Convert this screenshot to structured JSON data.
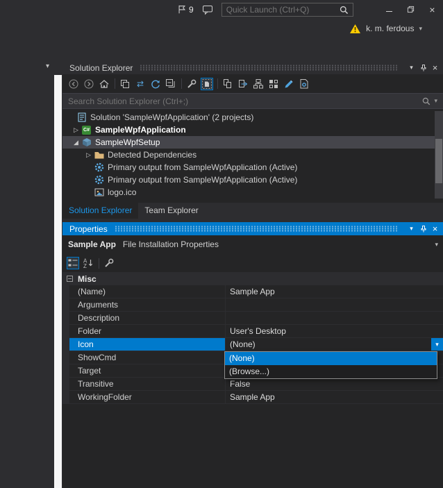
{
  "colors": {
    "background": "#2d2d30",
    "panel": "#252526",
    "accent_blue": "#007acc",
    "inactive_selection": "#45454b",
    "text": "#d0d0d0",
    "muted_text": "#999999",
    "folder_yellow": "#dcb67a",
    "warning_yellow": "#ffcc00",
    "active_tab_text": "#1c97ea"
  },
  "icons": {
    "chevron_down": "▾",
    "close": "×",
    "expander_collapsed": "▷",
    "expander_expanded": "◢",
    "csharp_label": "C#",
    "sync_arrows": "⇄"
  },
  "titlebar": {
    "notification_count": "9",
    "quick_launch_placeholder": "Quick Launch (Ctrl+Q)",
    "user_name": "k. m. ferdous"
  },
  "solution_explorer": {
    "title": "Solution Explorer",
    "search_placeholder": "Search Solution Explorer (Ctrl+;)",
    "tree": [
      {
        "label": "Solution 'SampleWpfApplication' (2 projects)"
      },
      {
        "label": "SampleWpfApplication",
        "bold": true
      },
      {
        "label": "SampleWpfSetup",
        "selected": true,
        "expanded": true
      },
      {
        "label": "Detected Dependencies"
      },
      {
        "label": "Primary output from SampleWpfApplication (Active)"
      },
      {
        "label": "Primary output from SampleWpfApplication (Active)"
      },
      {
        "label": "logo.ico"
      }
    ],
    "tabs": [
      {
        "label": "Solution Explorer",
        "active": true
      },
      {
        "label": "Team Explorer",
        "active": false
      }
    ]
  },
  "properties_panel": {
    "title": "Properties",
    "object_name": "Sample App",
    "object_type": "File Installation Properties",
    "category": "Misc",
    "rows": [
      {
        "name": "(Name)",
        "value": "Sample App"
      },
      {
        "name": "Arguments",
        "value": ""
      },
      {
        "name": "Description",
        "value": ""
      },
      {
        "name": "Folder",
        "value": "User's Desktop"
      },
      {
        "name": "Icon",
        "value": "(None)",
        "selected": true
      },
      {
        "name": "ShowCmd",
        "value": ""
      },
      {
        "name": "Target",
        "value": ""
      },
      {
        "name": "Transitive",
        "value": "False"
      },
      {
        "name": "WorkingFolder",
        "value": "Sample App"
      }
    ],
    "icon_dropdown": {
      "options": [
        {
          "label": "(None)",
          "highlighted": true
        },
        {
          "label": "(Browse...)",
          "highlighted": false
        }
      ]
    }
  }
}
